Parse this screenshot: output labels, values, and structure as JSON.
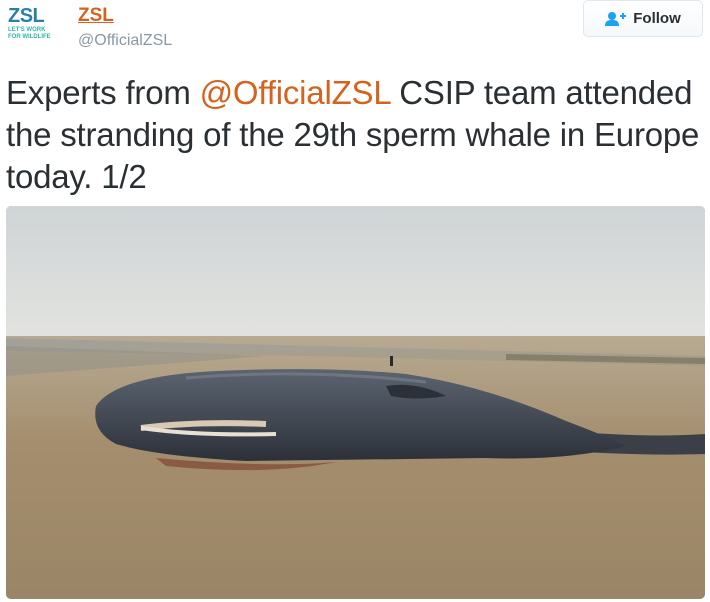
{
  "account": {
    "logo_text": "ZSL",
    "logo_tagline_1": "LET'S WORK",
    "logo_tagline_2": "FOR WILDLIFE",
    "display_name": "ZSL",
    "handle": "@OfficialZSL"
  },
  "follow_button": {
    "label": "Follow",
    "icon": "add-user-icon"
  },
  "tweet": {
    "text_before": "Experts from ",
    "mention": "@OfficialZSL",
    "text_after": " CSIP team attended the stranding of the 29th sperm whale in Europe today. 1/2"
  },
  "media": {
    "subject": "sperm-whale-photo"
  },
  "colors": {
    "brand_orange": "#d4631f",
    "logo_blue": "#2a7fa9",
    "logo_teal": "#30b6a6",
    "muted": "#8899a6"
  }
}
